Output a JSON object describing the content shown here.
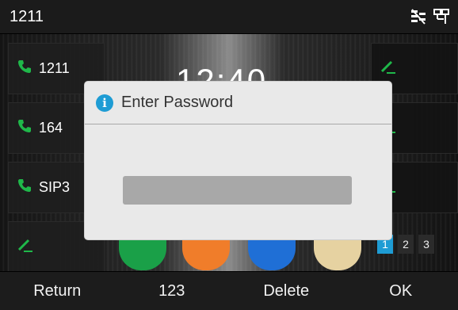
{
  "topbar": {
    "account": "1211",
    "icons": [
      "network-icon",
      "ethernet-icon"
    ]
  },
  "clock": {
    "time": "12:40"
  },
  "line_keys_left": [
    {
      "label": "1211",
      "icon": "phone-icon"
    },
    {
      "label": "164",
      "icon": "phone-icon"
    },
    {
      "label": "SIP3",
      "icon": "phone-icon"
    },
    {
      "label": "",
      "icon": "edit-icon"
    }
  ],
  "line_keys_right": [
    {
      "icon": "edit-icon"
    },
    {
      "icon": "edit-icon"
    },
    {
      "icon": "edit-icon"
    }
  ],
  "pages": [
    "1",
    "2",
    "3"
  ],
  "active_page": "1",
  "dialog": {
    "title": "Enter Password",
    "icon": "info-icon",
    "password_value": ""
  },
  "softkeys": [
    "Return",
    "123",
    "Delete",
    "OK"
  ],
  "colors": {
    "accent": "#1e9cd4",
    "phone_green": "#1fb84a",
    "dialog_bg": "#e9e9e9",
    "input_bg": "#a8a8a8"
  }
}
